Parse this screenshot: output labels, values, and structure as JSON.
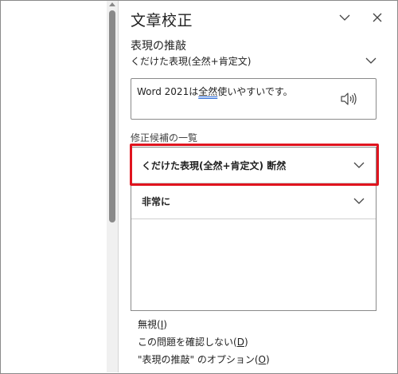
{
  "pane": {
    "title": "文章校正",
    "section_title": "表現の推敲",
    "category_label": "くだけた表現(全然+肯定文)"
  },
  "context": {
    "before": "Word 2021は",
    "flagged": "全然",
    "after": "使いやすいです。"
  },
  "suggestions_label": "修正候補の一覧",
  "suggestions": [
    {
      "label": "くだけた表現(全然+肯定文) 断然"
    },
    {
      "label": "非常に"
    }
  ],
  "options": {
    "ignore": {
      "text": "無視(",
      "key": "I",
      "close": ")"
    },
    "dont_check": {
      "text": "この問題を確認しない(",
      "key": "D",
      "close": ")"
    },
    "settings": {
      "text": "\"表現の推敲\" のオプション(",
      "key": "O",
      "close": ")"
    }
  },
  "colors": {
    "highlight": "#e0141e",
    "underline": "#2a6ad8",
    "scroll_thumb": "#8a8a8a"
  },
  "icons": {
    "collapse": "chevron-down-icon",
    "close": "close-icon",
    "speaker": "speaker-icon"
  }
}
